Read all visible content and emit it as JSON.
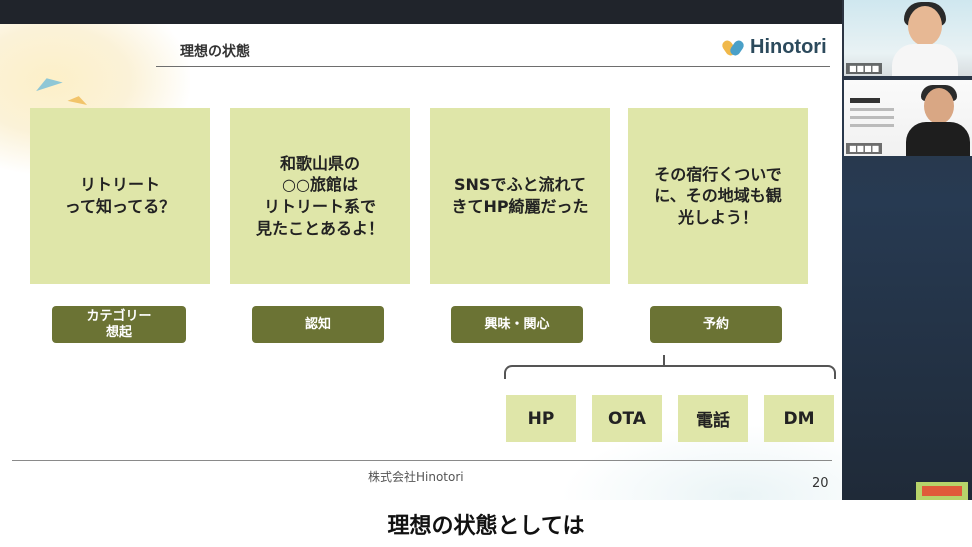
{
  "slide": {
    "title": "理想の状態",
    "logo_text": "Hinotori",
    "cards": [
      "リトリート\nって知ってる？",
      "和歌山県の\n○○旅館は\nリトリート系で\n見たことあるよ！",
      "SNSでふと流れて\nきてHP綺麗だった",
      "その宿行くついで\nに、その地域も観\n光しよう！"
    ],
    "stages": [
      "カテゴリー\n想起",
      "認知",
      "興味・関心",
      "予約"
    ],
    "channels": [
      "HP",
      "OTA",
      "電話",
      "DM"
    ],
    "footer_company": "株式会社Hinotori",
    "page_number": "20"
  },
  "subtitle": "理想の状態としては",
  "colors": {
    "card": "#dfe6a9",
    "stage": "#6b7334",
    "logo": "#2c4a5c"
  }
}
